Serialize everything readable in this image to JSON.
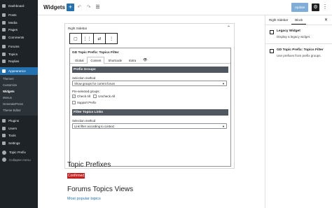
{
  "admin_menu": {
    "top": [
      {
        "name": "dashboard",
        "label": "Dashboard",
        "icon": "dashboard-icon"
      }
    ],
    "group1": [
      {
        "name": "posts",
        "label": "Posts",
        "icon": "pin-icon"
      },
      {
        "name": "media",
        "label": "Media",
        "icon": "media-icon"
      },
      {
        "name": "pages",
        "label": "Pages",
        "icon": "page-icon"
      },
      {
        "name": "comments",
        "label": "Comments",
        "icon": "comment-icon"
      }
    ],
    "group2": [
      {
        "name": "forums",
        "label": "Forums",
        "icon": "forums-icon"
      },
      {
        "name": "topics",
        "label": "Topics",
        "icon": "topics-icon"
      },
      {
        "name": "replies",
        "label": "Replies",
        "icon": "replies-icon"
      }
    ],
    "appearance": {
      "label": "Appearance",
      "icon": "brush-icon"
    },
    "appearance_sub": [
      "Themes",
      "Customize",
      "Widgets",
      "Menus",
      "GeneratePress",
      "Theme Editor"
    ],
    "group3": [
      {
        "name": "plugins",
        "label": "Plugins",
        "icon": "plugin-icon"
      },
      {
        "name": "users",
        "label": "Users",
        "icon": "users-icon"
      },
      {
        "name": "tools",
        "label": "Tools",
        "icon": "wrench-icon"
      },
      {
        "name": "settings",
        "label": "Settings",
        "icon": "settings-icon"
      }
    ],
    "topic_prefix": {
      "label": "Topic Prefix",
      "icon": "wordpress-icon"
    },
    "collapse": {
      "label": "Collapse menu",
      "icon": "collapse-icon"
    }
  },
  "toolbar": {
    "title": "Widgets",
    "add": "+",
    "undo": "↶",
    "redo": "↷",
    "list_view": "☰",
    "update": "Update",
    "settings_glyph": "⚙",
    "more_glyph": "⋮"
  },
  "settings_panel": {
    "tabs": [
      "Right Sidebar",
      "Block"
    ],
    "close": "✕",
    "blocks": [
      {
        "title": "Legacy Widget",
        "desc": "Display a legacy widget."
      },
      {
        "title": "GD Topic Prefix: Topics Filter",
        "desc": "Use prefixes from prefix groups."
      }
    ]
  },
  "widget_area": {
    "label": "Right Sidebar",
    "chevron": "⌃",
    "block_toolbar": [
      "▢",
      "⋮⋮",
      "⇄",
      "⋮"
    ],
    "legacy": {
      "title": "GD Topic Prefix: Topics Filter",
      "tabs": [
        "Global",
        "Content",
        "Shortcode",
        "Extra",
        "👁"
      ],
      "sections": {
        "prefix_groups": "Prefix Groups",
        "filter_links": "Filter Topics Links"
      },
      "selection_method_label": "Selection method",
      "selection_method_value": "Show groups for current forum",
      "preselected_label": "Pre-selected groups:",
      "check_all": "Check All",
      "uncheck_all": "Uncheck All",
      "support_prefix": "Support Prefix",
      "link_method_label": "Selection method",
      "link_method_value": "Link filter according to context"
    }
  },
  "content": {
    "heading1": "Topic Prefixes",
    "badge": "Confirmed",
    "heading2": "Forums Topics Views",
    "link": "Most popular topics"
  },
  "colors": {
    "admin_bg": "#1d2327",
    "accent": "#2271b1",
    "badge": "#c91c1c",
    "section_bar": "#50575e"
  }
}
